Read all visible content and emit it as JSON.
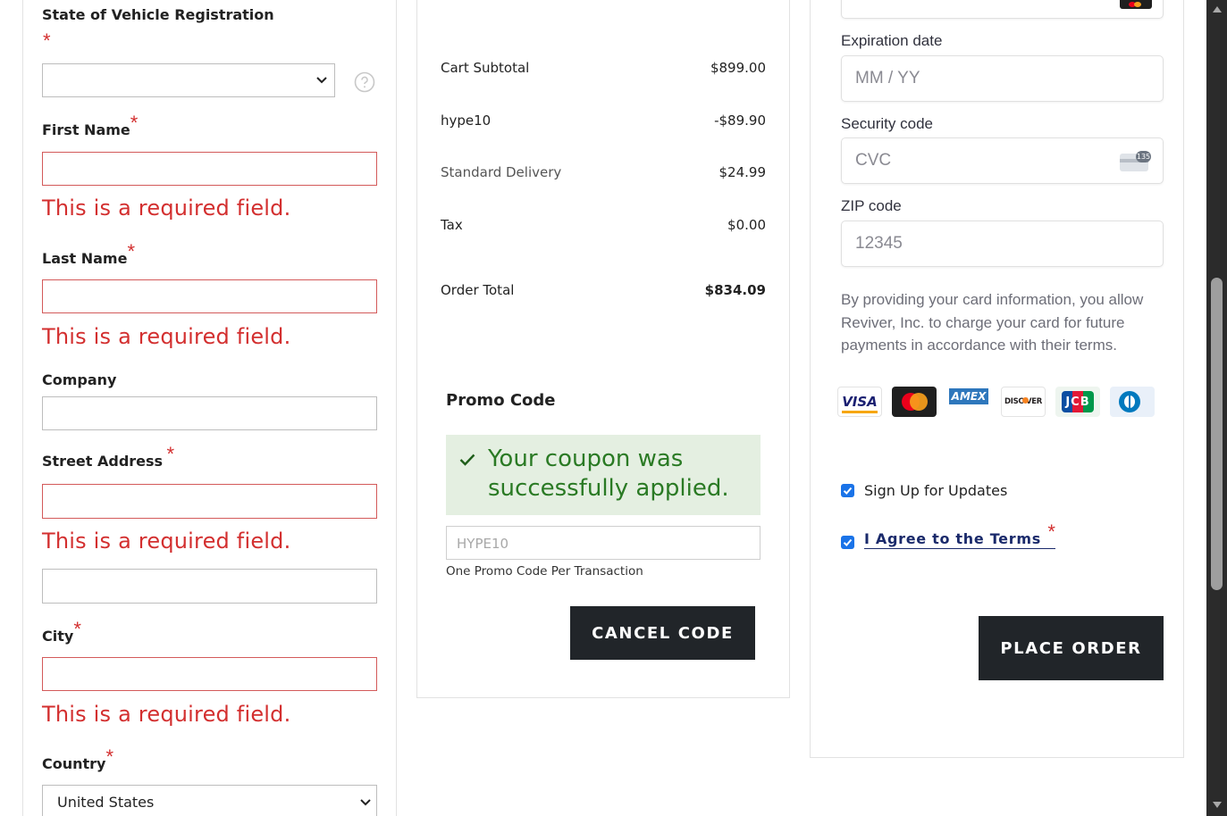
{
  "form": {
    "state_label": "State of Vehicle Registration",
    "required_mark": "*",
    "first_name_label": "First Name",
    "last_name_label": "Last Name",
    "company_label": "Company",
    "street_label": "Street Address",
    "city_label": "City",
    "country_label": "Country",
    "country_value": "United States",
    "error_text": "This is a required field."
  },
  "summary": {
    "rows": [
      {
        "label": "Cart Subtotal",
        "value": "$899.00"
      },
      {
        "label": "hype10",
        "value": "-$89.90"
      },
      {
        "label": "Standard Delivery",
        "value": "$24.99"
      },
      {
        "label": "Tax",
        "value": "$0.00"
      }
    ],
    "total_label": "Order Total",
    "total_value": "$834.09"
  },
  "promo": {
    "title": "Promo Code",
    "success_message": "Your coupon was successfully applied.",
    "code_value": "HYPE10",
    "note": "One Promo Code Per Transaction",
    "cancel_button": "CANCEL CODE"
  },
  "payment": {
    "expiration_label": "Expiration date",
    "expiration_placeholder": "MM / YY",
    "security_label": "Security code",
    "security_placeholder": "CVC",
    "cvc_badge": "135",
    "zip_label": "ZIP code",
    "zip_value": "12345",
    "disclaimer": "By providing your card information, you allow Reviver, Inc. to charge your card for future payments in accordance with their terms.",
    "card_brands": [
      "VISA",
      "mastercard",
      "AMEX",
      "DISCOVER",
      "JCB",
      "diners-club"
    ],
    "visa_text": "VISA",
    "amex_text": "AMEX",
    "discover_text": "DISC VER",
    "jcb_text": "JCB",
    "signup_label": "Sign Up for Updates",
    "agree_label": "I Agree to the Terms",
    "place_order_button": "PLACE ORDER"
  },
  "colors": {
    "error": "#d32f2f",
    "success_bg": "#e4efe1",
    "success_text": "#2a7a24",
    "button_dark": "#212529",
    "checkbox": "#1a73e8"
  }
}
